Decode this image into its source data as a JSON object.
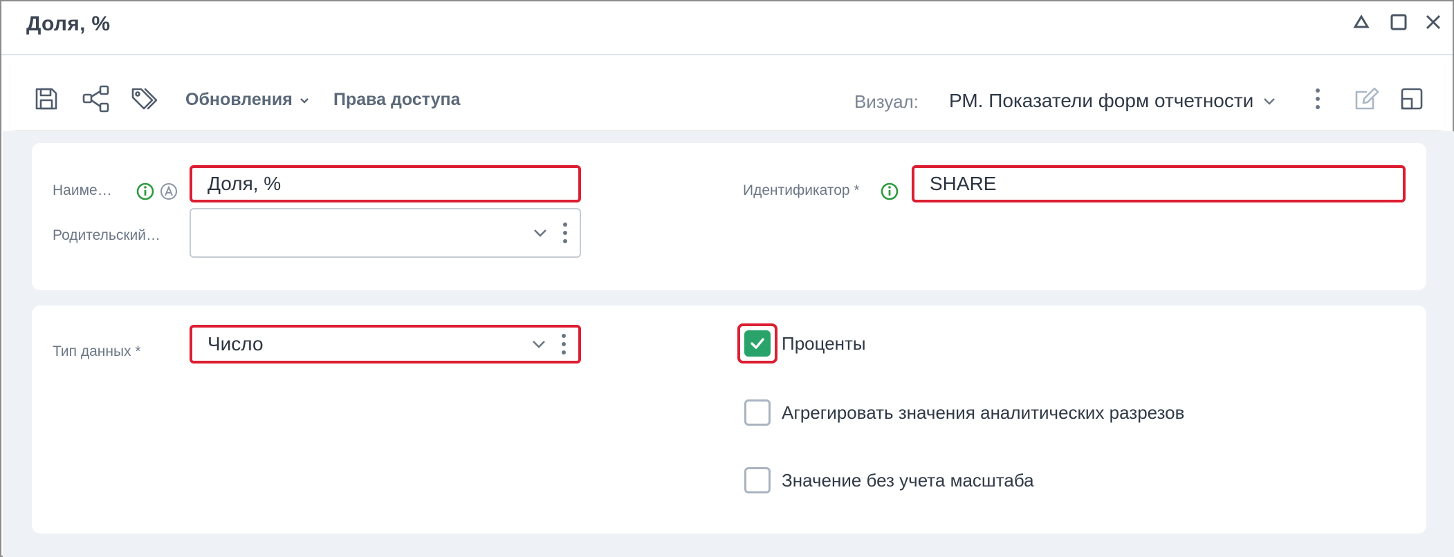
{
  "window": {
    "title": "Доля, %",
    "controls": [
      "collapse-icon",
      "maximize-icon",
      "close-icon"
    ]
  },
  "toolbar": {
    "icons": [
      "save-icon",
      "share-icon",
      "tags-icon"
    ],
    "updates_label": "Обновления",
    "access_label": "Права доступа",
    "visual_label": "Визуал:",
    "visual_value": "РМ. Показатели форм отчетности",
    "right_icons": [
      "edit-icon",
      "expand-icon"
    ]
  },
  "form": {
    "name_label": "Наиме…",
    "name_value": "Доля, %",
    "identifier_label": "Идентификатор *",
    "identifier_value": "SHARE",
    "parent_label": "Родительский…",
    "parent_value": "",
    "datatype_label": "Тип данных *",
    "datatype_value": "Число"
  },
  "options": [
    {
      "label": "Проценты",
      "checked": true
    },
    {
      "label": "Агрегировать значения аналитических разрезов",
      "checked": false
    },
    {
      "label": "Значение без учета масштаба",
      "checked": false
    }
  ],
  "colors": {
    "highlight": "#dc1e32",
    "check_green": "#29a36a",
    "info_green": "#2e9b3e"
  }
}
